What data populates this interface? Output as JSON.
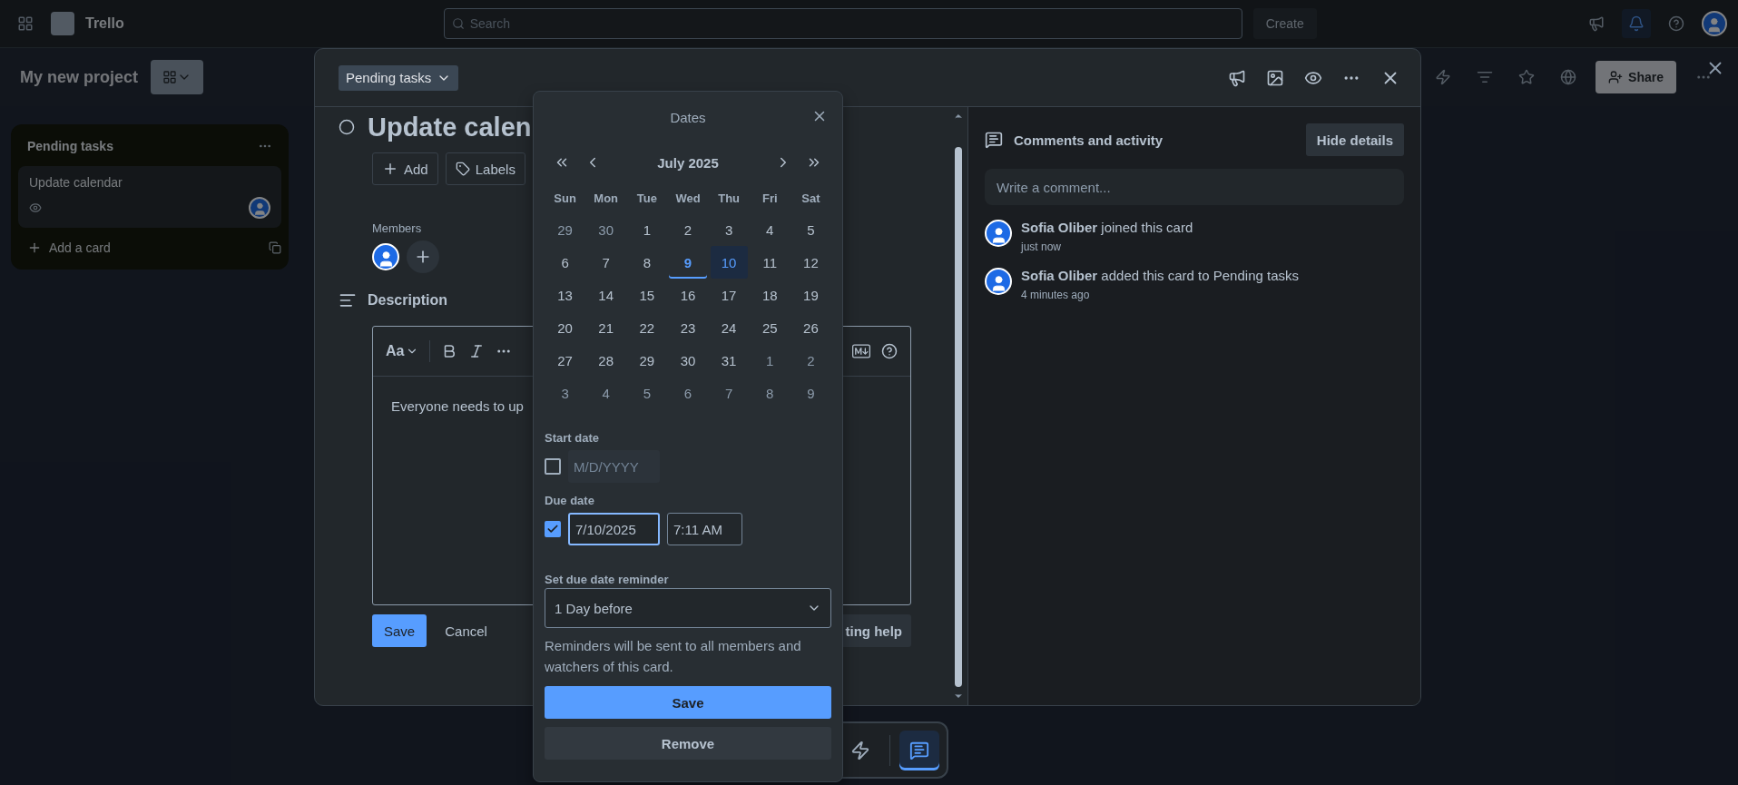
{
  "topbar": {
    "logo": "Trello",
    "search": {
      "placeholder": "Search"
    },
    "create": "Create"
  },
  "board": {
    "title": "My new project",
    "share": "Share",
    "list": {
      "title": "Pending tasks",
      "cards": [
        {
          "title": "Update calendar"
        }
      ],
      "add": "Add a card"
    }
  },
  "card": {
    "list_button": "Pending tasks",
    "title": "Update calen",
    "actions": [
      {
        "kind": "add",
        "label": "Add"
      },
      {
        "kind": "labels",
        "label": "Labels"
      }
    ],
    "members_label": "Members",
    "description_label": "Description",
    "editor": {
      "format": "Aa",
      "text": "Everyone needs to up"
    },
    "save": "Save",
    "cancel": "Cancel",
    "help_button": "ting help"
  },
  "activity": {
    "heading": "Comments and activity",
    "hide_button": "Hide details",
    "comment": {
      "placeholder": "Write a comment..."
    },
    "items": [
      {
        "name": "Sofia Oliber",
        "action": "joined this card",
        "time": "just now"
      },
      {
        "name": "Sofia Oliber",
        "action": "added this card to Pending tasks",
        "time": "4 minutes ago"
      }
    ]
  },
  "dates": {
    "title": "Dates",
    "month": "July 2025",
    "weekdays": [
      "Sun",
      "Mon",
      "Tue",
      "Wed",
      "Thu",
      "Fri",
      "Sat"
    ],
    "days": [
      {
        "label": "29",
        "outside": true,
        "today": false,
        "selected": false
      },
      {
        "label": "30",
        "outside": true,
        "today": false,
        "selected": false
      },
      {
        "label": "1",
        "outside": false,
        "today": false,
        "selected": false
      },
      {
        "label": "2",
        "outside": false,
        "today": false,
        "selected": false
      },
      {
        "label": "3",
        "outside": false,
        "today": false,
        "selected": false
      },
      {
        "label": "4",
        "outside": false,
        "today": false,
        "selected": false
      },
      {
        "label": "5",
        "outside": false,
        "today": false,
        "selected": false
      },
      {
        "label": "6",
        "outside": false,
        "today": false,
        "selected": false
      },
      {
        "label": "7",
        "outside": false,
        "today": false,
        "selected": false
      },
      {
        "label": "8",
        "outside": false,
        "today": false,
        "selected": false
      },
      {
        "label": "9",
        "outside": false,
        "today": true,
        "selected": false
      },
      {
        "label": "10",
        "outside": false,
        "today": false,
        "selected": true
      },
      {
        "label": "11",
        "outside": false,
        "today": false,
        "selected": false
      },
      {
        "label": "12",
        "outside": false,
        "today": false,
        "selected": false
      },
      {
        "label": "13",
        "outside": false,
        "today": false,
        "selected": false
      },
      {
        "label": "14",
        "outside": false,
        "today": false,
        "selected": false
      },
      {
        "label": "15",
        "outside": false,
        "today": false,
        "selected": false
      },
      {
        "label": "16",
        "outside": false,
        "today": false,
        "selected": false
      },
      {
        "label": "17",
        "outside": false,
        "today": false,
        "selected": false
      },
      {
        "label": "18",
        "outside": false,
        "today": false,
        "selected": false
      },
      {
        "label": "19",
        "outside": false,
        "today": false,
        "selected": false
      },
      {
        "label": "20",
        "outside": false,
        "today": false,
        "selected": false
      },
      {
        "label": "21",
        "outside": false,
        "today": false,
        "selected": false
      },
      {
        "label": "22",
        "outside": false,
        "today": false,
        "selected": false
      },
      {
        "label": "23",
        "outside": false,
        "today": false,
        "selected": false
      },
      {
        "label": "24",
        "outside": false,
        "today": false,
        "selected": false
      },
      {
        "label": "25",
        "outside": false,
        "today": false,
        "selected": false
      },
      {
        "label": "26",
        "outside": false,
        "today": false,
        "selected": false
      },
      {
        "label": "27",
        "outside": false,
        "today": false,
        "selected": false
      },
      {
        "label": "28",
        "outside": false,
        "today": false,
        "selected": false
      },
      {
        "label": "29",
        "outside": false,
        "today": false,
        "selected": false
      },
      {
        "label": "30",
        "outside": false,
        "today": false,
        "selected": false
      },
      {
        "label": "31",
        "outside": false,
        "today": false,
        "selected": false
      },
      {
        "label": "1",
        "outside": true,
        "today": false,
        "selected": false
      },
      {
        "label": "2",
        "outside": true,
        "today": false,
        "selected": false
      },
      {
        "label": "3",
        "outside": true,
        "today": false,
        "selected": false
      },
      {
        "label": "4",
        "outside": true,
        "today": false,
        "selected": false
      },
      {
        "label": "5",
        "outside": true,
        "today": false,
        "selected": false
      },
      {
        "label": "6",
        "outside": true,
        "today": false,
        "selected": false
      },
      {
        "label": "7",
        "outside": true,
        "today": false,
        "selected": false
      },
      {
        "label": "8",
        "outside": true,
        "today": false,
        "selected": false
      },
      {
        "label": "9",
        "outside": true,
        "today": false,
        "selected": false
      }
    ],
    "start_date": {
      "label": "Start date",
      "checked": false,
      "placeholder": "M/D/YYYY"
    },
    "due_date": {
      "label": "Due date",
      "checked": true,
      "date": "7/10/2025",
      "time": "7:11 AM"
    },
    "reminder": {
      "label": "Set due date reminder",
      "value": "1 Day before"
    },
    "note": "Reminders will be sent to all members and watchers of this card.",
    "save": "Save",
    "remove": "Remove"
  },
  "bottom_bar": [
    {
      "kind": "automation",
      "selected": false
    },
    {
      "kind": "comments",
      "selected": true
    }
  ]
}
